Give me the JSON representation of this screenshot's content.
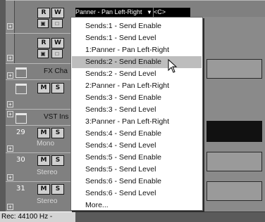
{
  "header": {
    "r_label": "R",
    "w_label": "W",
    "parameter": "Panner - Pan Left-Right",
    "value": "<C>"
  },
  "tracks": [
    {
      "name": "FX Cha",
      "m": "M",
      "s": "S"
    },
    {
      "name": "VST Ins",
      "m": "M",
      "s": "S"
    },
    {
      "number": "29",
      "sub": "Mono",
      "m": "M",
      "s": "S"
    },
    {
      "number": "30",
      "sub": "Stereo",
      "m": "M",
      "s": "S"
    },
    {
      "number": "31",
      "sub": "Stereo",
      "m": "M",
      "s": "S"
    }
  ],
  "status": "Rec: 44100 Hz -",
  "menu": {
    "items": [
      "Sends:1 - Send Enable",
      "Sends:1 - Send Level",
      "1:Panner - Pan Left-Right",
      "Sends:2 - Send Enable",
      "Sends:2 - Send Level",
      "2:Panner - Pan Left-Right",
      "Sends:3 - Send Enable",
      "Sends:3 - Send Level",
      "3:Panner - Pan Left-Right",
      "Sends:4 - Send Enable",
      "Sends:4 - Send Level",
      "Sends:5 - Send Enable",
      "Sends:5 - Send Level",
      "Sends:6 - Send Enable",
      "Sends:6 - Send Level",
      "More..."
    ],
    "highlighted_index": 3
  },
  "colors": {
    "menu_highlight": "#bdbdbd",
    "track_background": "#808080"
  }
}
